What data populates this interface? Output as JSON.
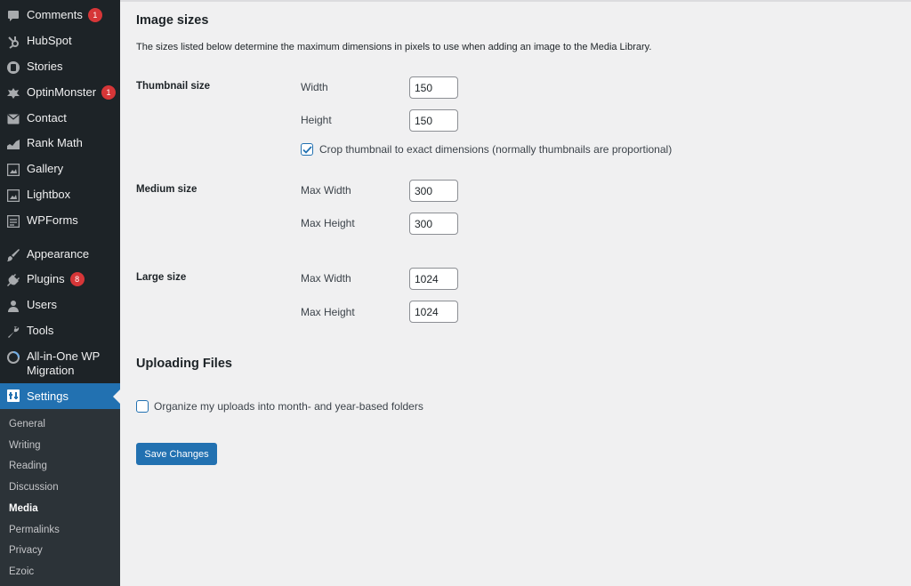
{
  "sidebar": {
    "items": [
      {
        "label": "Comments",
        "badge": "1",
        "icon": "comments-icon"
      },
      {
        "label": "HubSpot",
        "icon": "hubspot-icon"
      },
      {
        "label": "Stories",
        "icon": "stories-icon"
      },
      {
        "label": "OptinMonster",
        "badge": "1",
        "icon": "optinmonster-icon"
      },
      {
        "label": "Contact",
        "icon": "mail-icon"
      },
      {
        "label": "Rank Math",
        "icon": "rank-math-icon"
      },
      {
        "label": "Gallery",
        "icon": "gallery-icon"
      },
      {
        "label": "Lightbox",
        "icon": "lightbox-icon"
      },
      {
        "label": "WPForms",
        "icon": "wpforms-icon"
      },
      {
        "label": "Appearance",
        "icon": "brush-icon"
      },
      {
        "label": "Plugins",
        "badge": "8",
        "icon": "plug-icon"
      },
      {
        "label": "Users",
        "icon": "user-icon"
      },
      {
        "label": "Tools",
        "icon": "wrench-icon"
      },
      {
        "label": "All-in-One WP Migration",
        "icon": "migration-icon"
      },
      {
        "label": "Settings",
        "icon": "settings-icon"
      }
    ],
    "submenu": [
      "General",
      "Writing",
      "Reading",
      "Discussion",
      "Media",
      "Permalinks",
      "Privacy",
      "Ezoic"
    ],
    "current_submenu": "Media"
  },
  "image_sizes": {
    "heading": "Image sizes",
    "description": "The sizes listed below determine the maximum dimensions in pixels to use when adding an image to the Media Library.",
    "thumbnail": {
      "title": "Thumbnail size",
      "width_label": "Width",
      "width": "150",
      "height_label": "Height",
      "height": "150",
      "crop_label": "Crop thumbnail to exact dimensions (normally thumbnails are proportional)",
      "crop_checked": true
    },
    "medium": {
      "title": "Medium size",
      "width_label": "Max Width",
      "width": "300",
      "height_label": "Max Height",
      "height": "300"
    },
    "large": {
      "title": "Large size",
      "width_label": "Max Width",
      "width": "1024",
      "height_label": "Max Height",
      "height": "1024"
    }
  },
  "uploading": {
    "heading": "Uploading Files",
    "organize_label": "Organize my uploads into month- and year-based folders",
    "organize_checked": false
  },
  "save_label": "Save Changes",
  "colors": {
    "sidebar_bg": "#1d2327",
    "submenu_bg": "#2c3338",
    "accent": "#2271b1",
    "badge": "#d63638",
    "page_bg": "#f0f0f1"
  }
}
